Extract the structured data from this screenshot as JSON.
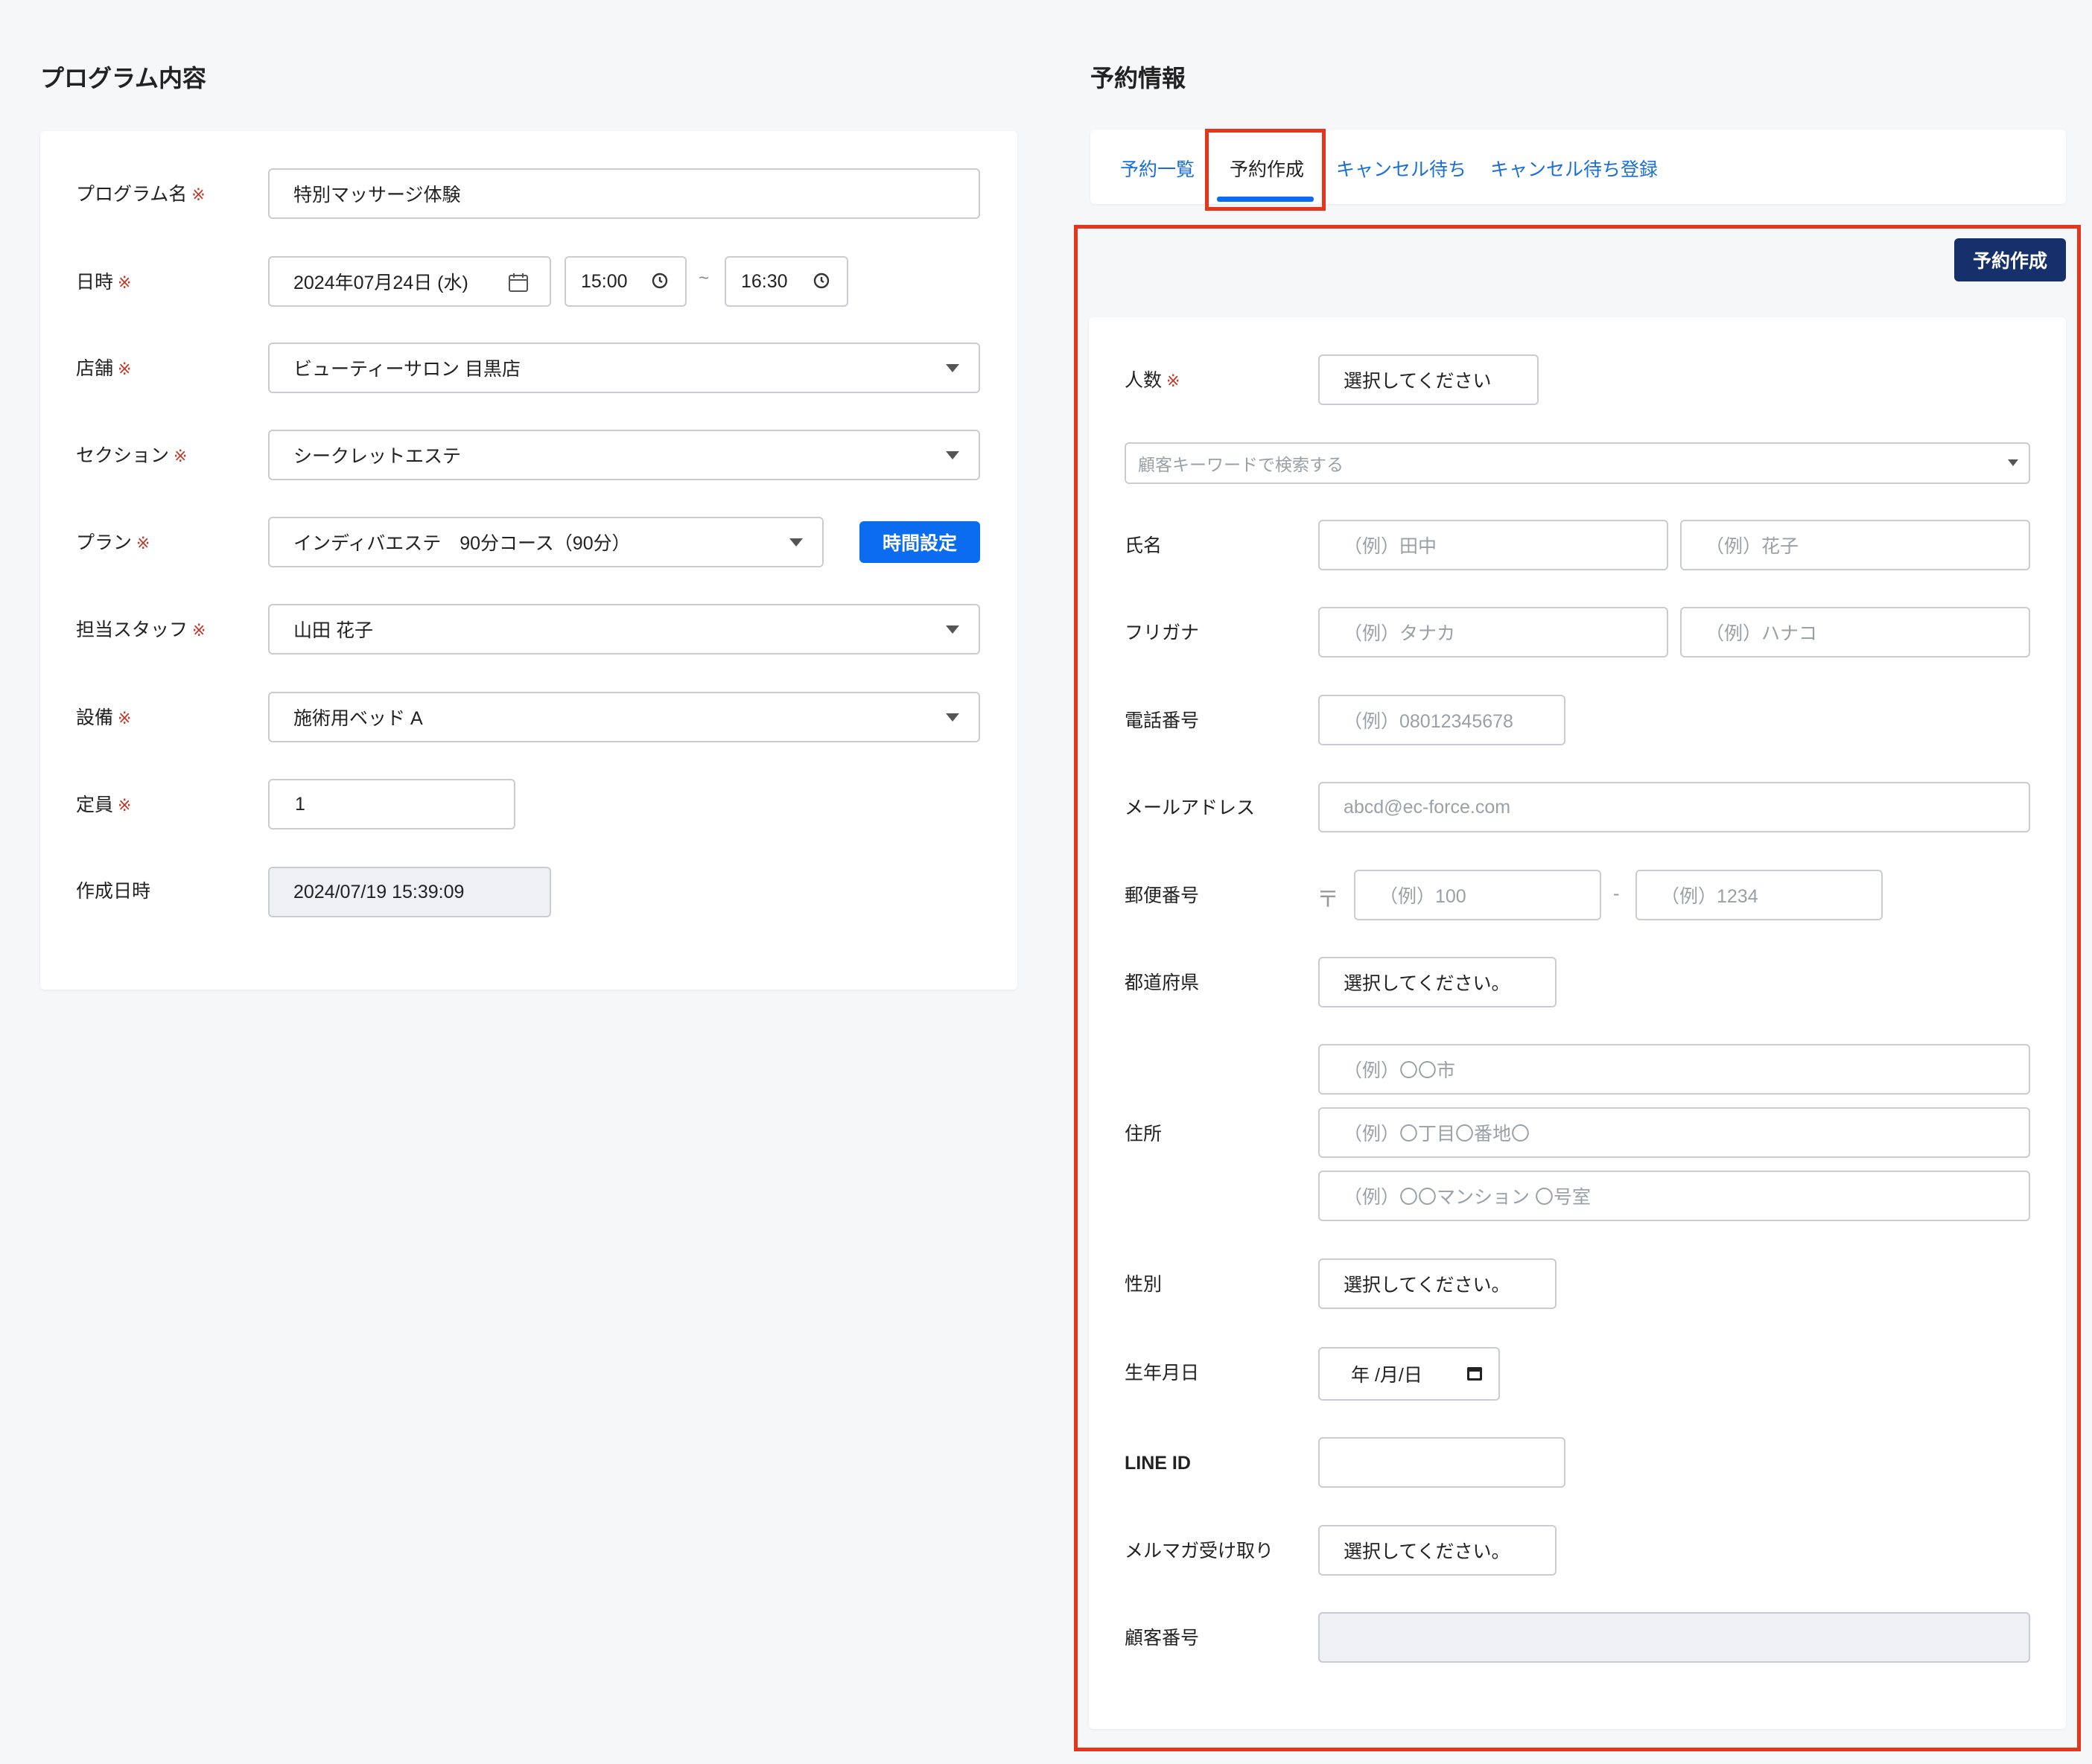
{
  "left": {
    "heading": "プログラム内容",
    "required_mark": "※",
    "fields": {
      "program_name": {
        "label": "プログラム名",
        "value": "特別マッサージ体験"
      },
      "datetime": {
        "label": "日時",
        "date": "2024年07月24日 (水)",
        "start": "15:00",
        "separator": "~",
        "end": "16:30"
      },
      "store": {
        "label": "店舗",
        "value": "ビューティーサロン 目黒店"
      },
      "section": {
        "label": "セクション",
        "value": "シークレットエステ"
      },
      "plan": {
        "label": "プラン",
        "value": "インディバエステ　90分コース（90分）",
        "button": "時間設定"
      },
      "staff": {
        "label": "担当スタッフ",
        "value": "山田 花子"
      },
      "equipment": {
        "label": "設備",
        "value": "施術用ベッド A"
      },
      "capacity": {
        "label": "定員",
        "value": "1"
      },
      "created_at": {
        "label": "作成日時",
        "value": "2024/07/19 15:39:09"
      }
    }
  },
  "right": {
    "heading": "予約情報",
    "tabs": [
      "予約一覧",
      "予約作成",
      "キャンセル待ち",
      "キャンセル待ち登録"
    ],
    "active_tab": 1,
    "create_button": "予約作成",
    "required_mark": "※",
    "form": {
      "people": {
        "label": "人数",
        "value": "選択してください"
      },
      "customer_search": {
        "placeholder": "顧客キーワードで検索する"
      },
      "name": {
        "label": "氏名",
        "ph1": "（例）田中",
        "ph2": "（例）花子"
      },
      "furigana": {
        "label": "フリガナ",
        "ph1": "（例）タナカ",
        "ph2": "（例）ハナコ"
      },
      "phone": {
        "label": "電話番号",
        "ph": "（例）08012345678"
      },
      "email": {
        "label": "メールアドレス",
        "ph": "abcd@ec-force.com"
      },
      "postal": {
        "label": "郵便番号",
        "mark": "〒",
        "ph1": "（例）100",
        "sep": "-",
        "ph2": "（例）1234"
      },
      "prefecture": {
        "label": "都道府県",
        "value": "選択してください。"
      },
      "address": {
        "label": "住所",
        "ph1": "（例）〇〇市",
        "ph2": "（例）〇丁目〇番地〇",
        "ph3": "（例）〇〇マンション 〇号室"
      },
      "gender": {
        "label": "性別",
        "value": "選択してください。"
      },
      "birthday": {
        "label": "生年月日",
        "value": "年 /月/日"
      },
      "line_id": {
        "label": "LINE ID",
        "value": ""
      },
      "newsletter": {
        "label": "メルマガ受け取り",
        "value": "選択してください。"
      },
      "customer_no": {
        "label": "顧客番号",
        "value": ""
      }
    }
  },
  "colors": {
    "primary": "#0b6cf0",
    "dark_button": "#15306b",
    "highlight": "#e5361b",
    "tab_link": "#1a6fd6",
    "required": "#c0392b"
  }
}
